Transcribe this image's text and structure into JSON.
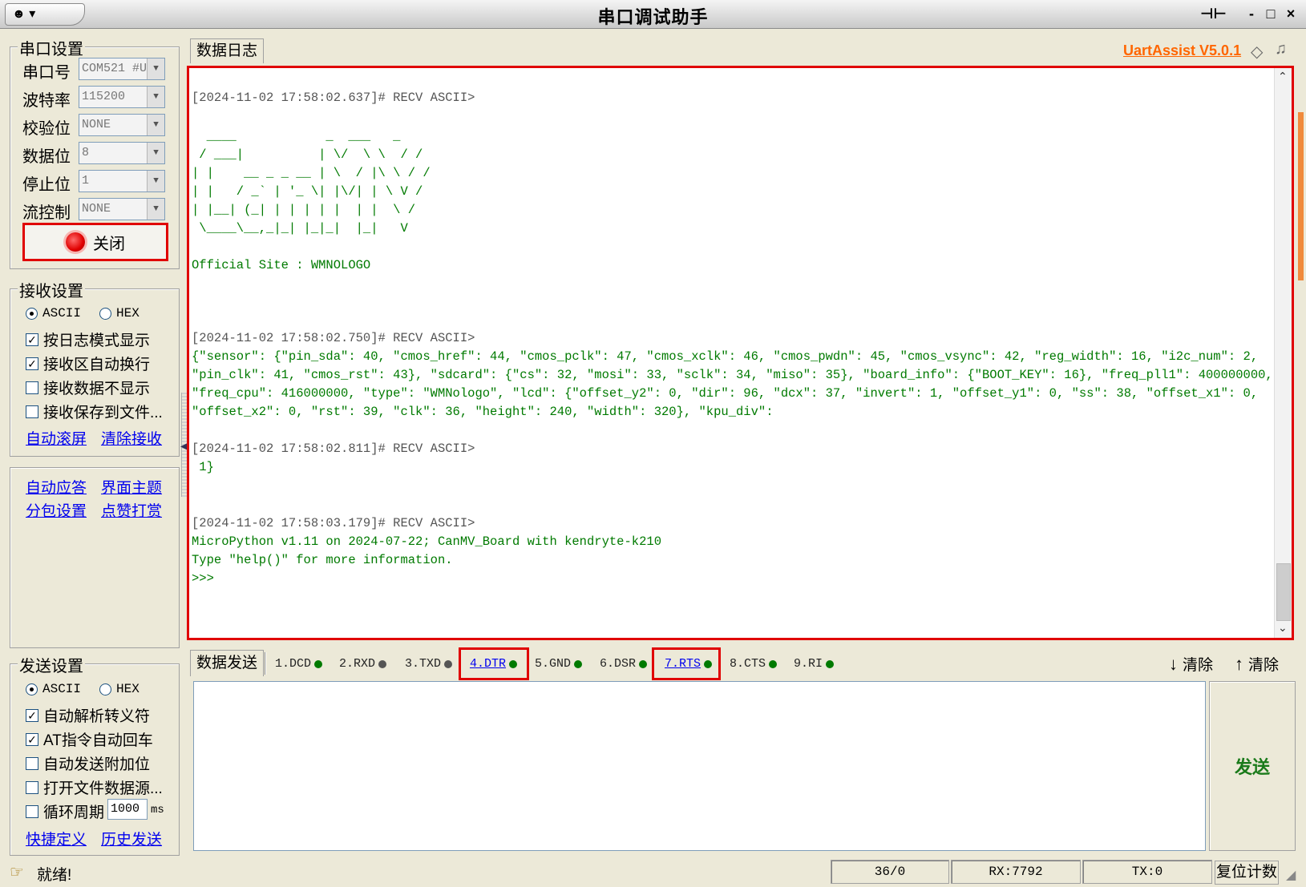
{
  "window": {
    "title": "串口调试助手",
    "sysmenu_glyph": "☻ ▾",
    "pin_icon": "⊣⊢",
    "minimize": "-",
    "maximize": "□",
    "close": "×"
  },
  "serial_settings": {
    "group_title": "串口设置",
    "port_label": "串口号",
    "port_value": "COM521 #U",
    "baud_label": "波特率",
    "baud_value": "115200",
    "parity_label": "校验位",
    "parity_value": "NONE",
    "databits_label": "数据位",
    "databits_value": "8",
    "stopbits_label": "停止位",
    "stopbits_value": "1",
    "flow_label": "流控制",
    "flow_value": "NONE",
    "open_close_button": "关闭"
  },
  "receive_settings": {
    "group_title": "接收设置",
    "ascii": "ASCII",
    "hex": "HEX",
    "log_mode": "按日志模式显示",
    "auto_wrap": "接收区自动换行",
    "hide_data": "接收数据不显示",
    "save_to_file": "接收保存到文件...",
    "auto_scroll": "自动滚屏",
    "clear_recv": "清除接收"
  },
  "misc_links": {
    "auto_reply": "自动应答",
    "theme": "界面主题",
    "packet_settings": "分包设置",
    "donate": "点赞打赏"
  },
  "send_settings": {
    "group_title": "发送设置",
    "ascii": "ASCII",
    "hex": "HEX",
    "parse_escape": "自动解析转义符",
    "at_auto_cr": "AT指令自动回车",
    "auto_append": "自动发送附加位",
    "open_file_source": "打开文件数据源...",
    "cycle_period": "循环周期",
    "cycle_value": "1000",
    "cycle_unit": "ms",
    "shortcuts": "快捷定义",
    "history": "历史发送"
  },
  "log_panel": {
    "tab": "数据日志",
    "version_link": "UartAssist V5.0.1",
    "lines": [
      {
        "t": "[2024-11-02 17:58:02.637]# RECV ASCII>",
        "k": "head"
      },
      {
        "t": "  ____            _  ___   _",
        "k": "body"
      },
      {
        "t": " / ___|          | \\/  \\ \\  / /",
        "k": "body"
      },
      {
        "t": "| |    __ _ _ __ | \\  / |\\ \\ / /",
        "k": "body"
      },
      {
        "t": "| |   / _` | '_ \\| |\\/| | \\ V /",
        "k": "body"
      },
      {
        "t": "| |__| (_| | | | | |  | |  \\ /",
        "k": "body"
      },
      {
        "t": " \\____\\__,_|_| |_|_|  |_|   V",
        "k": "body"
      },
      {
        "t": "Official Site : WMNOLOGO",
        "k": "body"
      },
      {
        "t": "[2024-11-02 17:58:02.750]# RECV ASCII>",
        "k": "head"
      },
      {
        "t": "{\"sensor\": {\"pin_sda\": 40, \"cmos_href\": 44, \"cmos_pclk\": 47, \"cmos_xclk\": 46, \"cmos_pwdn\": 45, \"cmos_vsync\": 42, \"reg_width\": 16, \"i2c_num\": 2,",
        "k": "body"
      },
      {
        "t": "\"pin_clk\": 41, \"cmos_rst\": 43}, \"sdcard\": {\"cs\": 32, \"mosi\": 33, \"sclk\": 34, \"miso\": 35}, \"board_info\": {\"BOOT_KEY\": 16}, \"freq_pll1\": 400000000,",
        "k": "body"
      },
      {
        "t": "\"freq_cpu\": 416000000, \"type\": \"WMNologo\", \"lcd\": {\"offset_y2\": 0, \"dir\": 96, \"dcx\": 37, \"invert\": 1, \"offset_y1\": 0, \"ss\": 38, \"offset_x1\": 0,",
        "k": "body"
      },
      {
        "t": "\"offset_x2\": 0, \"rst\": 39, \"clk\": 36, \"height\": 240, \"width\": 320}, \"kpu_div\":",
        "k": "body"
      },
      {
        "t": "[2024-11-02 17:58:02.811]# RECV ASCII>",
        "k": "head"
      },
      {
        "t": " 1}",
        "k": "body"
      },
      {
        "t": "[2024-11-02 17:58:03.179]# RECV ASCII>",
        "k": "head"
      },
      {
        "t": "MicroPython v1.11 on 2024-07-22; CanMV_Board with kendryte-k210",
        "k": "body"
      },
      {
        "t": "Type \"help()\" for more information.",
        "k": "body"
      },
      {
        "t": ">>>",
        "k": "body"
      }
    ]
  },
  "send_panel": {
    "tab": "数据发送",
    "pins": [
      {
        "label": "1.DCD",
        "color": "#007a00",
        "link": false
      },
      {
        "label": "2.RXD",
        "color": "#555555",
        "link": false
      },
      {
        "label": "3.TXD",
        "color": "#555555",
        "link": false
      },
      {
        "label": "4.DTR",
        "color": "#007a00",
        "link": true
      },
      {
        "label": "5.GND",
        "color": "#007a00",
        "link": false
      },
      {
        "label": "6.DSR",
        "color": "#007a00",
        "link": false
      },
      {
        "label": "7.RTS",
        "color": "#007a00",
        "link": true
      },
      {
        "label": "8.CTS",
        "color": "#007a00",
        "link": false
      },
      {
        "label": "9.RI",
        "color": "#007a00",
        "link": false
      }
    ],
    "clear_1": "清除",
    "clear_2": "清除",
    "send_button": "发送"
  },
  "status_bar": {
    "ready": "就绪!",
    "count": "36/0",
    "rx": "RX:7792",
    "tx": "TX:0",
    "reset": "复位计数"
  },
  "colors": {
    "highlight_box": "#e00000",
    "recv_text": "#007a00",
    "link": "#0000ee",
    "version_link": "#ff6600"
  }
}
